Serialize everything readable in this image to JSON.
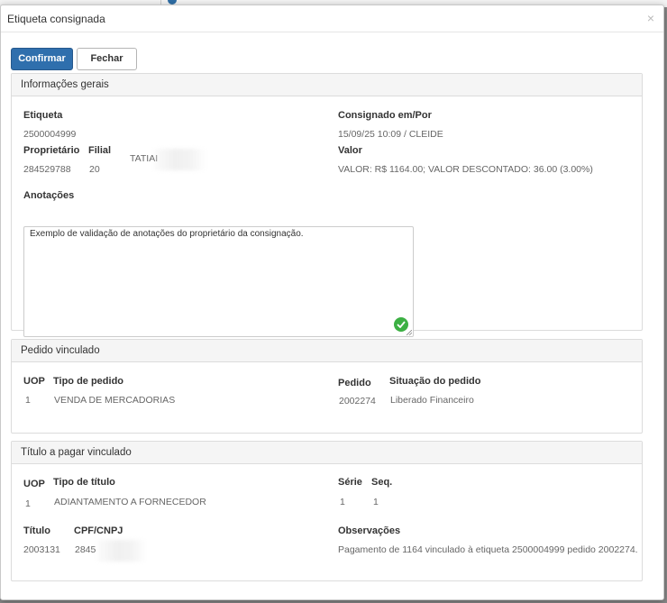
{
  "dialog": {
    "title": "Etiqueta consignada",
    "close_glyph": "×"
  },
  "toolbar": {
    "confirm_label": "Confirmar",
    "close_label": "Fechar"
  },
  "general": {
    "title": "Informações gerais",
    "etiqueta_label": "Etiqueta",
    "etiqueta_value": "2500004999",
    "consignado_label": "Consignado em/Por",
    "consignado_value": "15/09/25 10:09 / CLEIDE",
    "proprietario_label": "Proprietário",
    "proprietario_value": "284529788",
    "filial_label": "Filial",
    "filial_value": "20",
    "owner_name_partial": "TATIAI",
    "valor_label": "Valor",
    "valor_value": "VALOR: R$ 1164.00; VALOR DESCONTADO: 36.00 (3.00%)",
    "anotacoes_label": "Anotações",
    "anotacoes_value": "Exemplo de validação de anotações do proprietário da consignação."
  },
  "order": {
    "title": "Pedido vinculado",
    "uop_label": "UOP",
    "uop_value": "1",
    "tipo_label": "Tipo de pedido",
    "tipo_value": "VENDA DE MERCADORIAS",
    "pedido_label": "Pedido",
    "pedido_value": "2002274",
    "situacao_label": "Situação do pedido",
    "situacao_value": "Liberado Financeiro"
  },
  "payable": {
    "title": "Título a pagar vinculado",
    "uop_label": "UOP",
    "uop_value": "1",
    "tipo_label": "Tipo de título",
    "tipo_value": "ADIANTAMENTO A FORNECEDOR",
    "serie_label": "Série",
    "serie_value": "1",
    "seq_label": "Seq.",
    "seq_value": "1",
    "titulo_label": "Título",
    "titulo_value": "2003131",
    "cpf_label": "CPF/CNPJ",
    "cpf_value_partial": "2845",
    "obs_label": "Observações",
    "obs_value": "Pagamento de 1164 vinculado à etiqueta 2500004999 pedido 2002274."
  },
  "colors": {
    "primary": "#2f6fad",
    "success": "#3cb043"
  },
  "icons": {
    "close": "close-icon",
    "valid": "check-circle-icon",
    "resize": "resize-handle-icon"
  }
}
